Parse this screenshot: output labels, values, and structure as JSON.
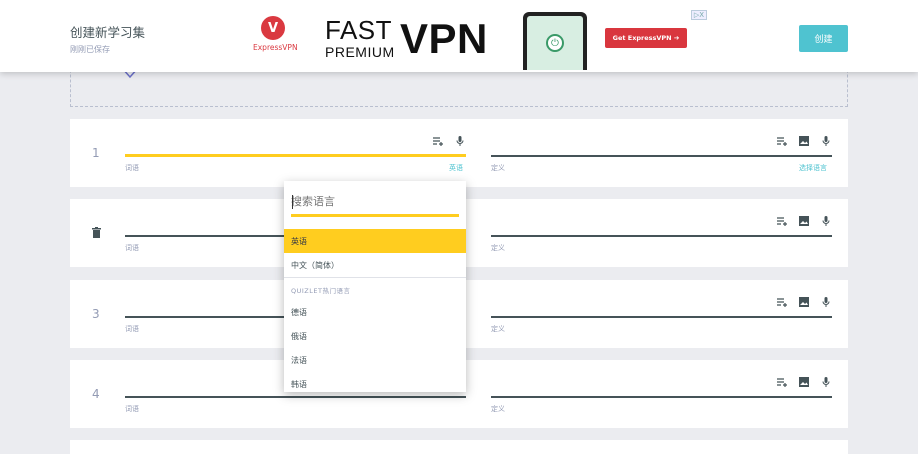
{
  "header": {
    "title": "创建新学习集",
    "save_status": "刚刚已保存",
    "create_label": "创建"
  },
  "ad": {
    "brand": "ExpressVPN",
    "logo_letter": "V",
    "headline_fast": "FAST",
    "headline_premium": "PREMIUM",
    "headline_vpn": "VPN",
    "cta": "Get ExpressVPN ➔",
    "close_label": "▷X"
  },
  "cards": [
    {
      "number": "1",
      "term_label": "词语",
      "term_lang": "英语",
      "def_label": "定义",
      "def_lang": "选择语言"
    },
    {
      "number": "",
      "term_label": "词语",
      "def_label": "定义"
    },
    {
      "number": "3",
      "term_label": "词语",
      "def_label": "定义"
    },
    {
      "number": "4",
      "term_label": "词语",
      "def_label": "定义"
    }
  ],
  "dropdown": {
    "search_placeholder": "搜索语言",
    "items_top": [
      "英语",
      "中文（简体）"
    ],
    "section_label": "QUIZLET热门语言",
    "items_popular": [
      "德语",
      "俄语",
      "法语",
      "韩语"
    ]
  },
  "colors": {
    "accent_yellow": "#ffcd1f",
    "accent_teal": "#4fc3d0",
    "brand_red": "#da3940"
  }
}
